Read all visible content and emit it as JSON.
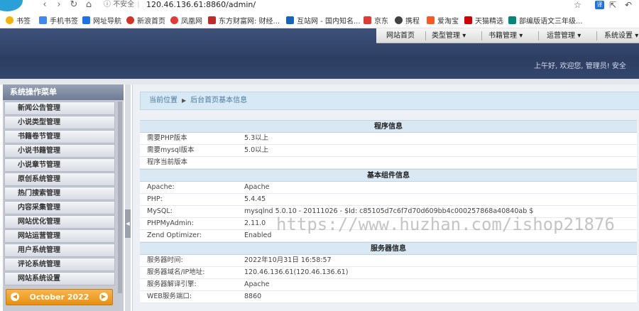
{
  "browser": {
    "security_label": "不安全",
    "url": "120.46.136.61:8860/admin/",
    "bookmarks": [
      {
        "label": "书签",
        "color": "#f4b400"
      },
      {
        "label": "手机书签",
        "color": "#4285f4"
      },
      {
        "label": "网址导航",
        "color": "#1a73e8"
      },
      {
        "label": "新浪首页",
        "color": "#d93025"
      },
      {
        "label": "凤凰网",
        "color": "#e53935"
      },
      {
        "label": "东方财富网: 财经...",
        "color": "#c62828"
      },
      {
        "label": "互站网 - 国内知名...",
        "color": "#1565c0"
      },
      {
        "label": "京东",
        "color": "#e53935"
      },
      {
        "label": "携程",
        "color": "#424242"
      },
      {
        "label": "爱淘宝",
        "color": "#ff5722"
      },
      {
        "label": "天猫精选",
        "color": "#d50000"
      },
      {
        "label": "部编版语文三年级...",
        "color": "#00897b"
      }
    ]
  },
  "topnav": {
    "home": "网站首页",
    "category": "类型管理",
    "books": "书籍管理",
    "ops": "运营管理",
    "settings": "系统设置"
  },
  "greeting": "上午好, 欢迎您, 管理员!   安全",
  "sidebar": {
    "title": "系统操作菜单",
    "items": [
      "新闻公告管理",
      "小说类型管理",
      "书籍卷节管理",
      "小说书籍管理",
      "小说章节管理",
      "原创系统管理",
      "热门搜索管理",
      "内容采集管理",
      "网站优化管理",
      "网站运营管理",
      "用户系统管理",
      "评论系统管理",
      "网站系统设置"
    ],
    "calendar": "October 2022"
  },
  "breadcrumb": {
    "label": "当前位置",
    "page": "后台首页基本信息"
  },
  "sections": {
    "program": {
      "title": "程序信息",
      "rows": [
        {
          "k": "需要PHP版本",
          "v": "5.3以上"
        },
        {
          "k": "需要mysql版本",
          "v": "5.0以上"
        },
        {
          "k": "程序当前版本",
          "v": ""
        }
      ]
    },
    "components": {
      "title": "基本组件信息",
      "rows": [
        {
          "k": "Apache:",
          "v": "Apache"
        },
        {
          "k": "PHP:",
          "v": "5.4.45"
        },
        {
          "k": "MySQL:",
          "v": "mysqlnd 5.0.10 - 20111026 - $Id: c85105d7c6f7d70d609bb4c000257868a40840ab $"
        },
        {
          "k": "PHPMyAdmin:",
          "v": "2.11.0"
        },
        {
          "k": "Zend Optimizer:",
          "v": "Enabled"
        }
      ]
    },
    "server": {
      "title": "服务器信息",
      "rows": [
        {
          "k": "服务器时间:",
          "v": "2022年10月31日 16:58:57"
        },
        {
          "k": "服务器域名/IP地址:",
          "v": "120.46.136.61(120.46.136.61)"
        },
        {
          "k": "服务器解译引擎:",
          "v": "Apache"
        },
        {
          "k": "WEB服务端口:",
          "v": "8860"
        }
      ]
    }
  },
  "watermark": "https://www.huzhan.com/ishop21876"
}
